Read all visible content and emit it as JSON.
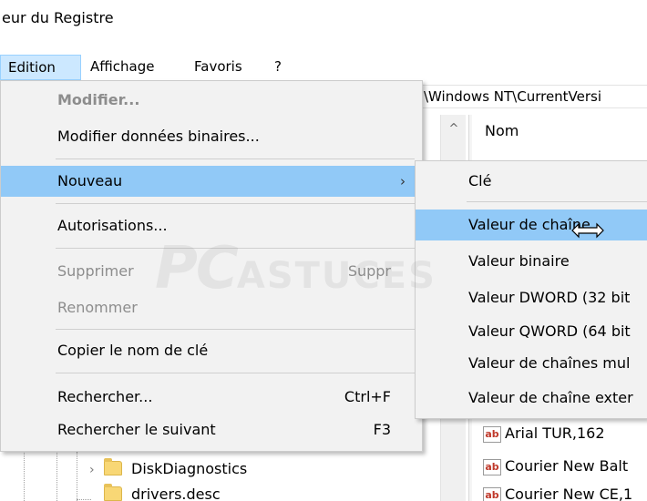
{
  "window": {
    "title": "eur du Registre"
  },
  "menubar": {
    "items": [
      "Edition",
      "Affichage",
      "Favoris",
      "?"
    ]
  },
  "address": {
    "path": "\\Windows NT\\CurrentVersi"
  },
  "list": {
    "column_name": "Nom",
    "values": [
      "Arial TUR,162",
      "Courier New Balt",
      "Courier New CE,1"
    ]
  },
  "tree": {
    "items": [
      "DiskDiagnostics",
      "drivers.desc"
    ]
  },
  "edit_menu": {
    "modify": "Modifier...",
    "modify_binary": "Modifier données binaires...",
    "new": "Nouveau",
    "permissions": "Autorisations...",
    "delete": "Supprimer",
    "delete_shortcut": "Suppr",
    "rename": "Renommer",
    "copy_key_name": "Copier le nom de clé",
    "find": "Rechercher...",
    "find_shortcut": "Ctrl+F",
    "find_next": "Rechercher le suivant",
    "find_next_shortcut": "F3",
    "submenu_arrow": "›"
  },
  "new_submenu": {
    "key": "Clé",
    "string_value": "Valeur de chaîne",
    "binary_value": "Valeur binaire",
    "dword_value": "Valeur DWORD (32 bit",
    "qword_value": "Valeur QWORD (64 bit",
    "multi_string_value": "Valeur de chaînes mul",
    "expandable_string_value": "Valeur de chaîne exter"
  },
  "icons": {
    "value_icon_text": "ab",
    "scroll_up": "^",
    "chevron_right": "›"
  },
  "watermark": {
    "part1": "PC",
    "part2": "ASTUCES"
  },
  "colors": {
    "highlight": "#91c9f7",
    "menu_active": "#cce8ff",
    "menu_background": "#f2f2f2",
    "disabled_text": "#8d8d8d"
  }
}
